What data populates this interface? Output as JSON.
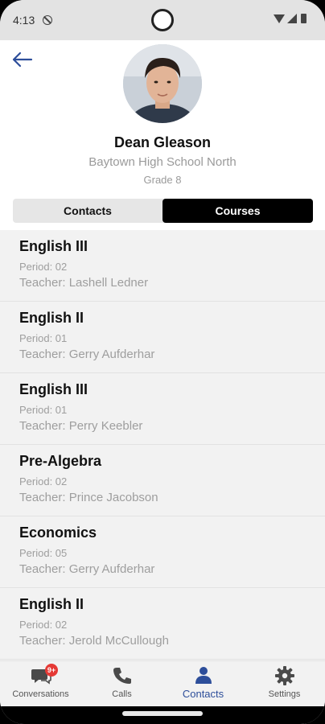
{
  "status_bar": {
    "time": "4:13"
  },
  "profile": {
    "name": "Dean Gleason",
    "school": "Baytown High School North",
    "grade": "Grade 8"
  },
  "tabs": [
    {
      "label": "Contacts",
      "active": false
    },
    {
      "label": "Courses",
      "active": true
    }
  ],
  "courses": [
    {
      "title": "English III",
      "period": "Period: 02",
      "teacher": "Teacher: Lashell Ledner"
    },
    {
      "title": "English II",
      "period": "Period: 01",
      "teacher": "Teacher: Gerry Aufderhar"
    },
    {
      "title": "English III",
      "period": "Period: 01",
      "teacher": "Teacher: Perry Keebler"
    },
    {
      "title": "Pre-Algebra",
      "period": "Period: 02",
      "teacher": "Teacher: Prince Jacobson"
    },
    {
      "title": "Economics",
      "period": "Period: 05",
      "teacher": "Teacher: Gerry Aufderhar"
    },
    {
      "title": "English II",
      "period": "Period: 02",
      "teacher": "Teacher: Jerold McCullough"
    }
  ],
  "bottom_nav": {
    "items": [
      {
        "label": "Conversations",
        "icon": "chat-icon",
        "badge": "9+"
      },
      {
        "label": "Calls",
        "icon": "phone-icon"
      },
      {
        "label": "Contacts",
        "icon": "person-icon",
        "active": true
      },
      {
        "label": "Settings",
        "icon": "gear-icon"
      }
    ]
  },
  "colors": {
    "accent": "#2d4e9a",
    "badge": "#e53935",
    "active_tab": "#000000"
  }
}
